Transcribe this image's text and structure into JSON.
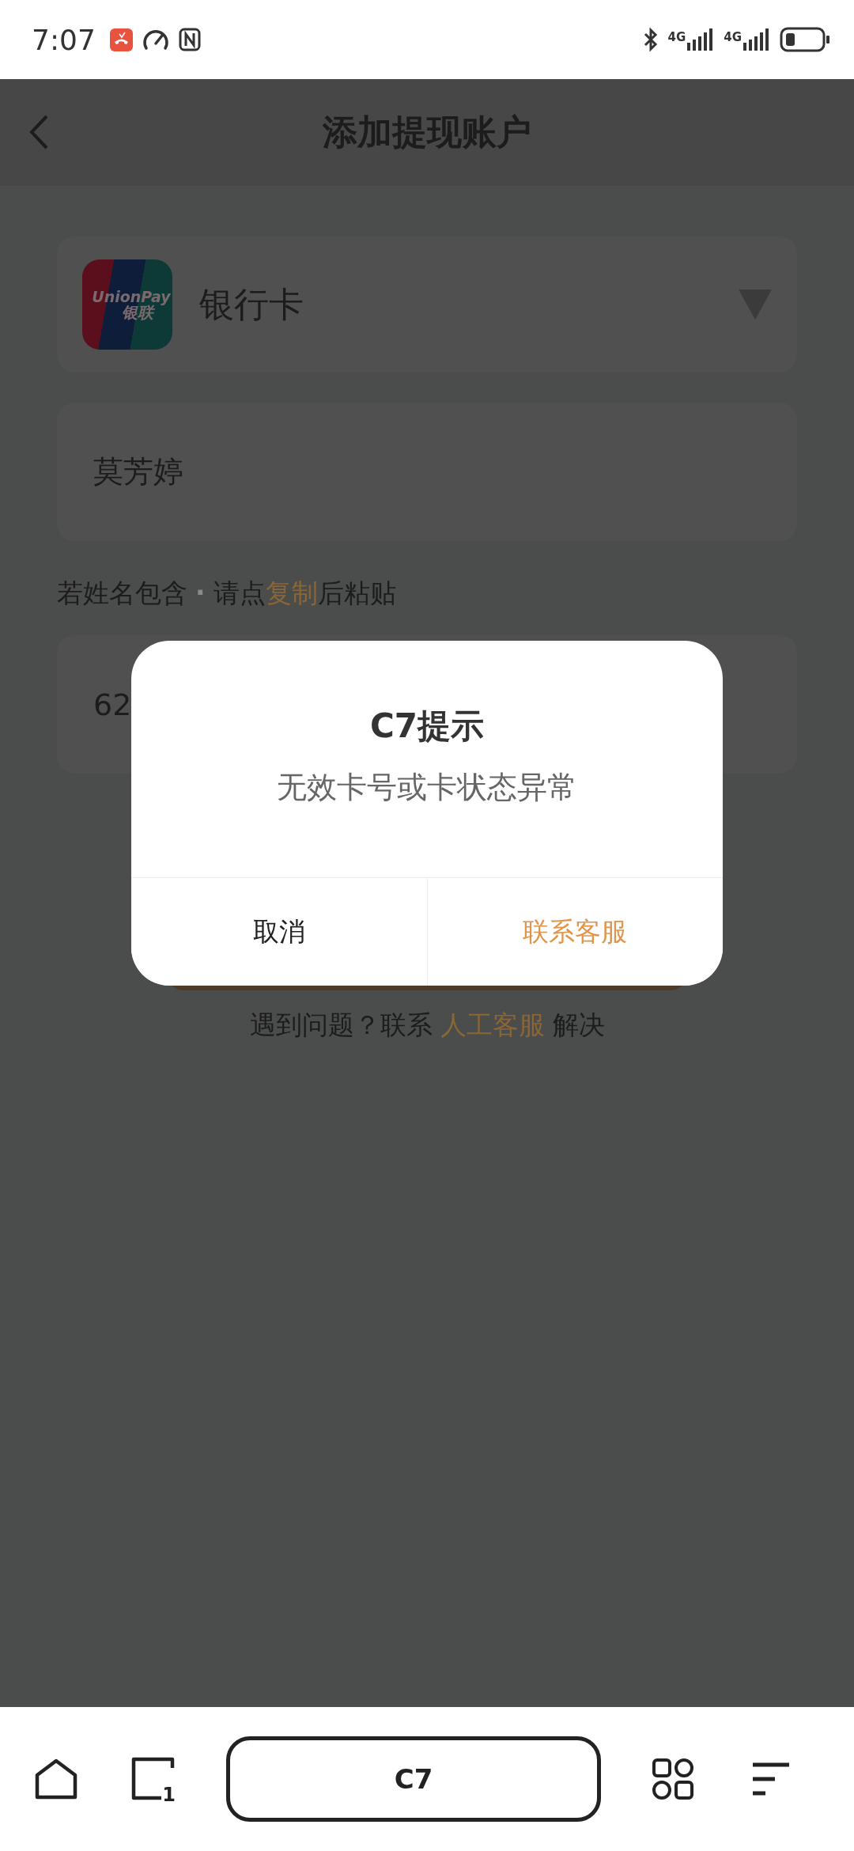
{
  "status_bar": {
    "time": "7:07",
    "network_labels": [
      "4G",
      "4G"
    ]
  },
  "header": {
    "title": "添加提现账户"
  },
  "account_type": {
    "logo": {
      "line_1": "UnionPay",
      "line_2": "银联"
    },
    "label": "银行卡"
  },
  "name_field": {
    "value": "莫芳婷"
  },
  "hint": [
    {
      "kind": "text",
      "text": "若姓名包含"
    },
    {
      "kind": "dot",
      "text": "·"
    },
    {
      "kind": "text",
      "text": "请点"
    },
    {
      "kind": "link",
      "text": "复制"
    },
    {
      "kind": "text",
      "text": "后粘贴"
    }
  ],
  "card_number_field": {
    "value": "62"
  },
  "help": [
    {
      "kind": "text",
      "text": "遇到问题？联系"
    },
    {
      "kind": "link",
      "text": "人工客服"
    },
    {
      "kind": "text",
      "text": "解决"
    }
  ],
  "dialog": {
    "title": "C7提示",
    "message": "无效卡号或卡状态异常",
    "buttons": [
      {
        "label": "取消",
        "kind": "cancel"
      },
      {
        "label": "联系客服",
        "kind": "primary"
      }
    ]
  },
  "bottom_bar": {
    "address": "C7",
    "tab_count": "1"
  }
}
